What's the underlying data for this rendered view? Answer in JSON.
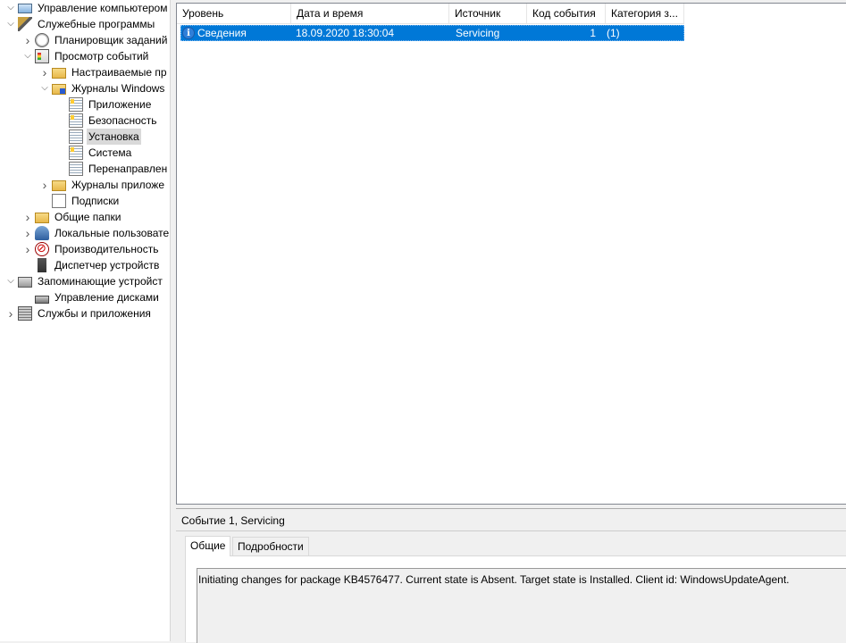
{
  "tree": [
    {
      "label": "Управление компьютером (л",
      "expand": "v",
      "icon": "computer-icon",
      "cls": "ic-computer",
      "indent": 0,
      "selected": false
    },
    {
      "label": "Служебные программы",
      "expand": "v",
      "icon": "tools-icon",
      "cls": "ic-tools",
      "indent": 0,
      "selected": false
    },
    {
      "label": "Планировщик заданий",
      "expand": ">",
      "icon": "clock-icon",
      "cls": "ic-clock",
      "indent": 1,
      "selected": false
    },
    {
      "label": "Просмотр событий",
      "expand": "v",
      "icon": "event-viewer-icon",
      "cls": "ic-eventlog",
      "indent": 1,
      "selected": false
    },
    {
      "label": "Настраиваемые пр",
      "expand": ">",
      "icon": "folder-icon",
      "cls": "ic-folder",
      "indent": 2,
      "selected": false
    },
    {
      "label": "Журналы Windows",
      "expand": "v",
      "icon": "windows-logs-folder-icon",
      "cls": "ic-folder-win",
      "indent": 2,
      "selected": false
    },
    {
      "label": "Приложение",
      "expand": "",
      "icon": "log-icon",
      "cls": "ic-log warn",
      "indent": 3,
      "selected": false
    },
    {
      "label": "Безопасность",
      "expand": "",
      "icon": "log-icon",
      "cls": "ic-log warn",
      "indent": 3,
      "selected": false
    },
    {
      "label": "Установка",
      "expand": "",
      "icon": "log-icon",
      "cls": "ic-log",
      "indent": 3,
      "selected": true
    },
    {
      "label": "Система",
      "expand": "",
      "icon": "log-icon",
      "cls": "ic-log warn",
      "indent": 3,
      "selected": false
    },
    {
      "label": "Перенаправлен",
      "expand": "",
      "icon": "log-icon",
      "cls": "ic-log",
      "indent": 3,
      "selected": false
    },
    {
      "label": "Журналы приложе",
      "expand": ">",
      "icon": "folder-icon",
      "cls": "ic-folder",
      "indent": 2,
      "selected": false
    },
    {
      "label": "Подписки",
      "expand": "",
      "icon": "subscriptions-icon",
      "cls": "ic-subs",
      "indent": 2,
      "selected": false
    },
    {
      "label": "Общие папки",
      "expand": ">",
      "icon": "shared-folders-icon",
      "cls": "ic-shared",
      "indent": 1,
      "selected": false
    },
    {
      "label": "Локальные пользовате",
      "expand": ">",
      "icon": "users-icon",
      "cls": "ic-users",
      "indent": 1,
      "selected": false
    },
    {
      "label": "Производительность",
      "expand": ">",
      "icon": "performance-icon",
      "cls": "ic-perf",
      "indent": 1,
      "selected": false
    },
    {
      "label": "Диспетчер устройств",
      "expand": "",
      "icon": "device-manager-icon",
      "cls": "ic-device",
      "indent": 1,
      "selected": false
    },
    {
      "label": "Запоминающие устройст",
      "expand": "v",
      "icon": "storage-icon",
      "cls": "ic-storage",
      "indent": 0,
      "selected": false
    },
    {
      "label": "Управление дисками",
      "expand": "",
      "icon": "disk-icon",
      "cls": "ic-disk",
      "indent": 1,
      "selected": false
    },
    {
      "label": "Службы и приложения",
      "expand": ">",
      "icon": "services-icon",
      "cls": "ic-services",
      "indent": 0,
      "selected": false
    }
  ],
  "list": {
    "columns": [
      "Уровень",
      "Дата и время",
      "Источник",
      "Код события",
      "Категория з..."
    ],
    "rows": [
      {
        "level": "Сведения",
        "datetime": "18.09.2020 18:30:04",
        "source": "Servicing",
        "event_id": "1",
        "category": "(1)"
      }
    ]
  },
  "details": {
    "title": "Событие 1, Servicing",
    "tabs": [
      "Общие",
      "Подробности"
    ],
    "message": "Initiating changes for package KB4576477. Current state is Absent. Target state is Installed. Client id: WindowsUpdateAgent."
  },
  "colors": {
    "selection": "#0078d7",
    "info_icon": "#2f7fd9"
  }
}
